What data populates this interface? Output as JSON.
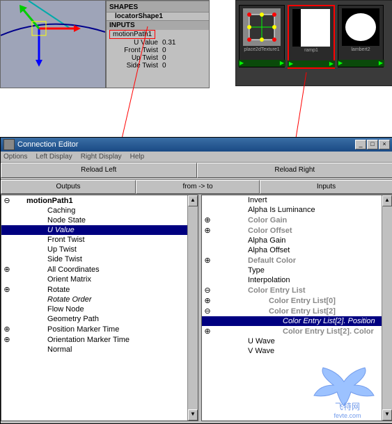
{
  "viewport": {},
  "channelbox": {
    "locator_shape": "locatorShape1",
    "inputs_header": "INPUTS",
    "motion_path": "motionPath1",
    "attrs": [
      {
        "label": "U Value",
        "value": "0.31"
      },
      {
        "label": "Front Twist",
        "value": "0"
      },
      {
        "label": "Up Twist",
        "value": "0"
      },
      {
        "label": "Side Twist",
        "value": "0"
      }
    ]
  },
  "hypershade": {
    "nodes": [
      {
        "name": "place2dTexture1"
      },
      {
        "name": "ramp1"
      },
      {
        "name": "lambert2"
      }
    ]
  },
  "conn_editor": {
    "title": "Connection Editor",
    "menu": [
      "Options",
      "Left Display",
      "Right Display",
      "Help"
    ],
    "reload_left": "Reload Left",
    "reload_right": "Reload Right",
    "outputs_header": "Outputs",
    "from_to": "from -> to",
    "inputs_header": "Inputs",
    "left_items": [
      {
        "pm": "⊖",
        "text": "motionPath1",
        "root": true
      },
      {
        "pm": "",
        "text": "Caching"
      },
      {
        "pm": "",
        "text": "Node State"
      },
      {
        "pm": "",
        "text": "U Value",
        "selected": true,
        "italic": true
      },
      {
        "pm": "",
        "text": "Front Twist"
      },
      {
        "pm": "",
        "text": "Up Twist"
      },
      {
        "pm": "",
        "text": "Side Twist"
      },
      {
        "pm": "⊕",
        "text": "All Coordinates"
      },
      {
        "pm": "",
        "text": "Orient Matrix"
      },
      {
        "pm": "⊕",
        "text": "Rotate"
      },
      {
        "pm": "",
        "text": "Rotate Order",
        "italic": true
      },
      {
        "pm": "",
        "text": "Flow Node"
      },
      {
        "pm": "",
        "text": "Geometry Path"
      },
      {
        "pm": "⊕",
        "text": "Position Marker Time"
      },
      {
        "pm": "⊕",
        "text": "Orientation Marker Time"
      },
      {
        "pm": "",
        "text": "Normal"
      }
    ],
    "right_items": [
      {
        "pm": "",
        "text": "Invert"
      },
      {
        "pm": "",
        "text": "Alpha Is Luminance"
      },
      {
        "pm": "⊕",
        "text": "Color Gain",
        "bold": true,
        "gray": true
      },
      {
        "pm": "⊕",
        "text": "Color Offset",
        "bold": true,
        "gray": true
      },
      {
        "pm": "",
        "text": "Alpha Gain"
      },
      {
        "pm": "",
        "text": "Alpha Offset"
      },
      {
        "pm": "⊕",
        "text": "Default Color",
        "bold": true,
        "gray": true
      },
      {
        "pm": "",
        "text": "Type"
      },
      {
        "pm": "",
        "text": "Interpolation"
      },
      {
        "pm": "⊖",
        "text": "Color Entry List",
        "bold": true,
        "gray": true
      },
      {
        "pm": "⊕",
        "text": "Color Entry List[0]",
        "indent": 2,
        "bold": true,
        "gray": true
      },
      {
        "pm": "⊖",
        "text": "Color Entry List[2]",
        "indent": 2,
        "bold": true,
        "gray": true
      },
      {
        "pm": "",
        "text": "Color Entry List[2]. Position",
        "selected": true,
        "italic": true,
        "indent": 3
      },
      {
        "pm": "⊕",
        "text": "Color Entry List[2]. Color",
        "indent": 3,
        "bold": true,
        "gray": true
      },
      {
        "pm": "",
        "text": "U Wave"
      },
      {
        "pm": "",
        "text": "V Wave"
      }
    ]
  },
  "watermark": {
    "text": "飞特网",
    "url": "fevte.com"
  }
}
